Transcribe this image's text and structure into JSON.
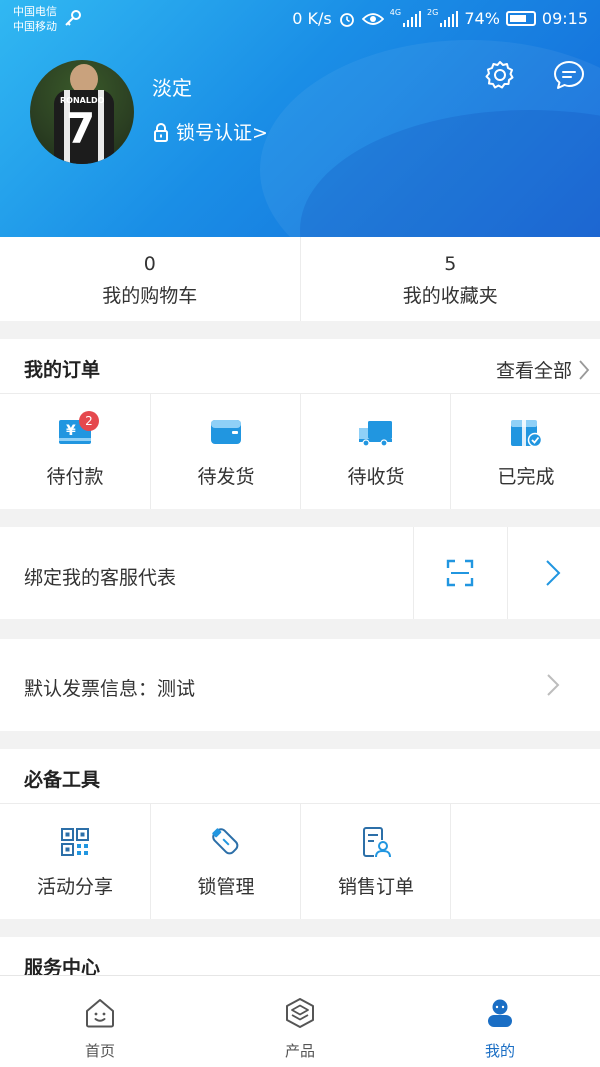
{
  "status_bar": {
    "carrier_1": "中国电信",
    "carrier_2": "中国移动",
    "speed": "0 K/s",
    "net_4g": "4G",
    "net_2g": "2G",
    "battery": "74%",
    "time": "09:15"
  },
  "profile": {
    "name": "淡定",
    "lock_auth": "锁号认证>",
    "avatar_number": "7",
    "avatar_text": "RONALDO"
  },
  "stats": [
    {
      "value": "0",
      "label": "我的购物车"
    },
    {
      "value": "5",
      "label": "我的收藏夹"
    }
  ],
  "orders": {
    "title": "我的订单",
    "see_all": "查看全部",
    "items": [
      {
        "label": "待付款",
        "icon": "payment-icon",
        "badge": "2"
      },
      {
        "label": "待发货",
        "icon": "box-icon"
      },
      {
        "label": "待收货",
        "icon": "truck-icon"
      },
      {
        "label": "已完成",
        "icon": "gift-check-icon"
      }
    ]
  },
  "bind_service": {
    "label": "绑定我的客服代表"
  },
  "invoice": {
    "label": "默认发票信息：测试"
  },
  "tools": {
    "title": "必备工具",
    "items": [
      {
        "label": "活动分享",
        "icon": "qr-code-icon"
      },
      {
        "label": "锁管理",
        "icon": "key-icon"
      },
      {
        "label": "销售订单",
        "icon": "sales-order-icon"
      }
    ]
  },
  "service_center": {
    "title": "服务中心"
  },
  "tabbar": [
    {
      "label": "首页",
      "icon": "home-icon"
    },
    {
      "label": "产品",
      "icon": "product-icon"
    },
    {
      "label": "我的",
      "icon": "me-icon",
      "active": true
    }
  ],
  "colors": {
    "header_start": "#31b8f2",
    "header_end": "#1468d8",
    "icon_blue": "#2196e0",
    "active_tab": "#1a6ec4",
    "badge_red": "#e5484d"
  }
}
